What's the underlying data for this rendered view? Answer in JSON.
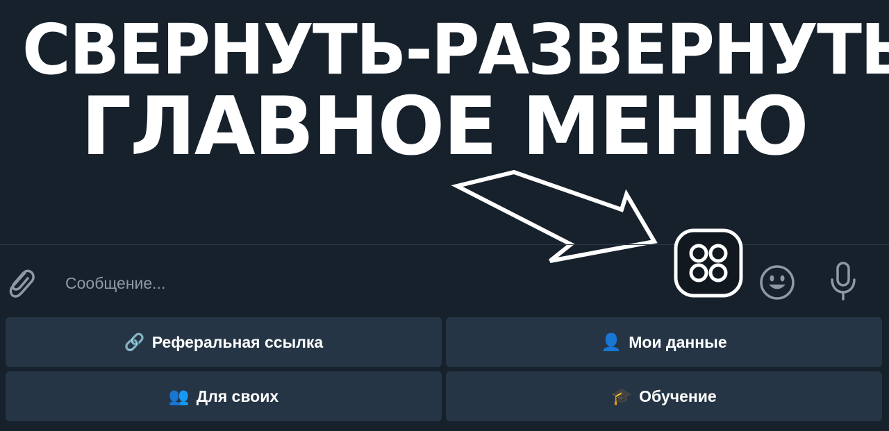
{
  "headline": {
    "line1": "СВЕРНУТЬ-РАЗВЕРНУТЬ",
    "line2": "ГЛАВНОЕ МЕНЮ"
  },
  "input": {
    "placeholder": "Сообщение..."
  },
  "icons": {
    "attach": "paperclip-icon",
    "menu": "bot-menu-four-circles-icon",
    "emoji": "smiley-icon",
    "mic": "microphone-icon"
  },
  "keyboard": [
    {
      "emoji": "🔗",
      "label": "Реферальная ссылка"
    },
    {
      "emoji": "👤",
      "label": "Мои данные"
    },
    {
      "emoji": "👥",
      "label": "Для своих"
    },
    {
      "emoji": "🎓",
      "label": "Обучение"
    }
  ],
  "colors": {
    "background": "#17212b",
    "button": "#253545",
    "icon": "#8d9aa6"
  }
}
